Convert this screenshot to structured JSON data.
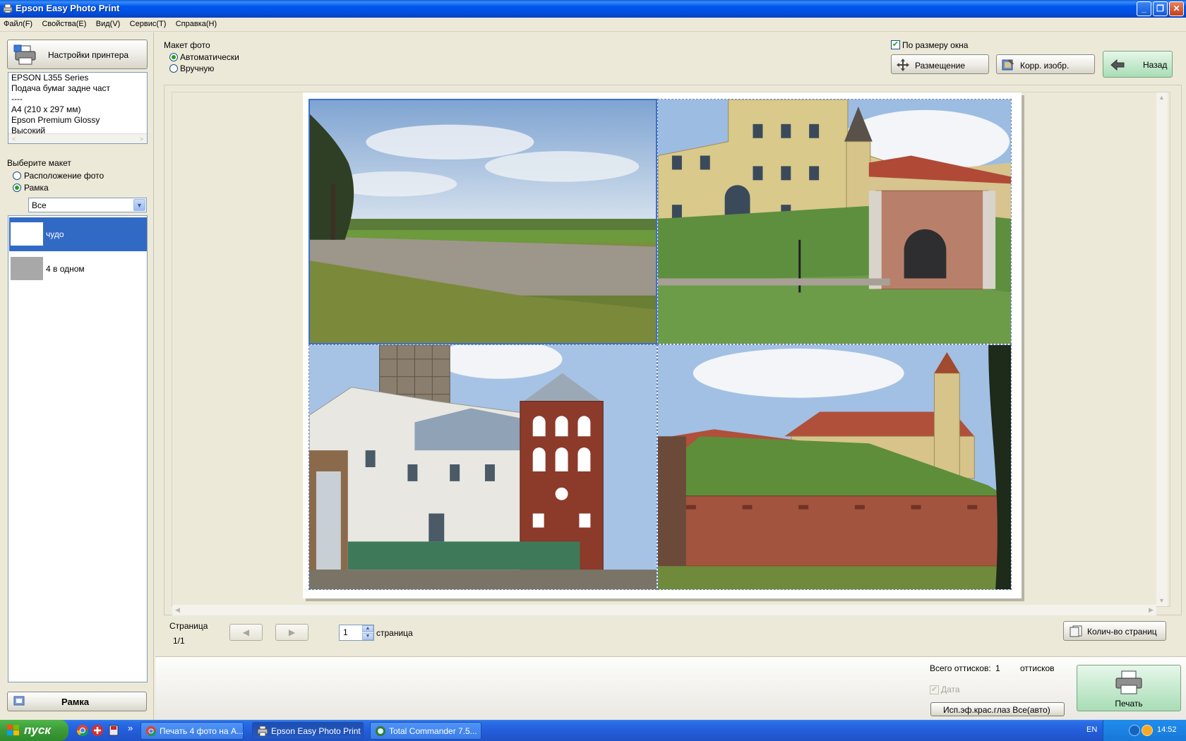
{
  "window": {
    "title": "Epson Easy Photo Print",
    "min_glyph": "_",
    "max_glyph": "❐",
    "close_glyph": "✕"
  },
  "menu": [
    "Файл(F)",
    "Свойства(E)",
    "Вид(V)",
    "Сервис(T)",
    "Справка(H)"
  ],
  "left": {
    "printer_button": "Настройки принтера",
    "printer_info": [
      "EPSON L355 Series",
      "Подача бумаг задне част",
      "----",
      "A4 (210 x 297 мм)",
      "Epson Premium Glossy",
      "Высокий"
    ],
    "choose_layout": "Выберите макет",
    "radio_placement": "Расположение фото",
    "radio_frame": "Рамка",
    "layout_mode": "frame",
    "filter_value": "Все",
    "frames": [
      {
        "name": "чудо",
        "selected": true
      },
      {
        "name": "4 в одном",
        "selected": false
      }
    ],
    "frame_button": "Рамка"
  },
  "top": {
    "photo_layout_label": "Макет фото",
    "radio_auto": "Автоматически",
    "radio_manual": "Вручную",
    "layout_choice": "auto",
    "fit_window_label": "По размеру окна",
    "fit_window_checked": true,
    "placement_button": "Размещение",
    "correct_button": "Корр. изобр.",
    "back_button": "Назад"
  },
  "preview": {
    "photos": [
      {
        "subject": "field-road",
        "selected": true
      },
      {
        "subject": "castle-yellow",
        "selected": false
      },
      {
        "subject": "church-tower",
        "selected": false
      },
      {
        "subject": "castle-wall",
        "selected": false
      }
    ]
  },
  "pager": {
    "page_label": "Страница",
    "page_counter": "1/1",
    "prev_glyph": "◀",
    "next_glyph": "▶",
    "page_value": "1",
    "page_word": "страница",
    "pages_count_button": "Колич-во страниц"
  },
  "bottom": {
    "total_label": "Всего оттисков:",
    "total_value": "1",
    "total_unit": "оттисков",
    "date_label": "Дата",
    "date_checked": true,
    "eye_button": "Исп.эф.крас.глаз Все(авто)",
    "print_button": "Печать"
  },
  "taskbar": {
    "start_label": "пуск",
    "tasks": [
      {
        "label": "Печать 4 фото на А...",
        "active": false
      },
      {
        "label": "Epson Easy Photo Print",
        "active": true
      },
      {
        "label": "Total Commander 7.5...",
        "active": false
      }
    ],
    "overflow_glyph": "»",
    "lang": "EN",
    "clock": "14:52"
  },
  "colors": {
    "accent_selection": "#316AC5",
    "print_button": "#A8DDB5",
    "titlebar": "#0050E0"
  }
}
